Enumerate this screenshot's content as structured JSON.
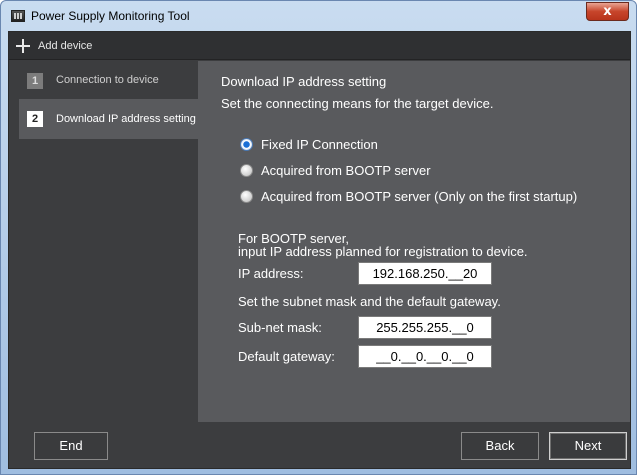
{
  "window": {
    "title": "Power Supply Monitoring Tool",
    "close_glyph": "x"
  },
  "toolbar": {
    "add_device_label": "Add device",
    "add_icon": "plus-icon"
  },
  "sidebar": {
    "steps": [
      {
        "number": "1",
        "label": "Connection to device",
        "active": false
      },
      {
        "number": "2",
        "label": "Download IP address setting",
        "active": true
      }
    ]
  },
  "main": {
    "heading": "Download IP address setting",
    "instruction": "Set the connecting means for the target device.",
    "radio_options": [
      {
        "label": "Fixed IP Connection",
        "checked": true
      },
      {
        "label": "Acquired from BOOTP server",
        "checked": false
      },
      {
        "label": "Acquired from BOOTP server (Only on the first startup)",
        "checked": false
      }
    ],
    "bootp_note_line1": "For BOOTP server,",
    "bootp_note_line2": "input IP address planned for registration to device.",
    "ip_label": "IP address:",
    "ip_value": "192.168.250.__20",
    "subnet_note": "Set the subnet mask and the default gateway.",
    "subnet_label": "Sub-net mask:",
    "subnet_value": "255.255.255.__0",
    "gateway_label": "Default gateway:",
    "gateway_value": "__0.__0.__0.__0"
  },
  "footer": {
    "end_label": "End",
    "back_label": "Back",
    "next_label": "Next"
  },
  "colors": {
    "content_bg": "#595a5d",
    "client_bg": "#3c3d3f",
    "radio_accent": "#1a6fd6"
  }
}
